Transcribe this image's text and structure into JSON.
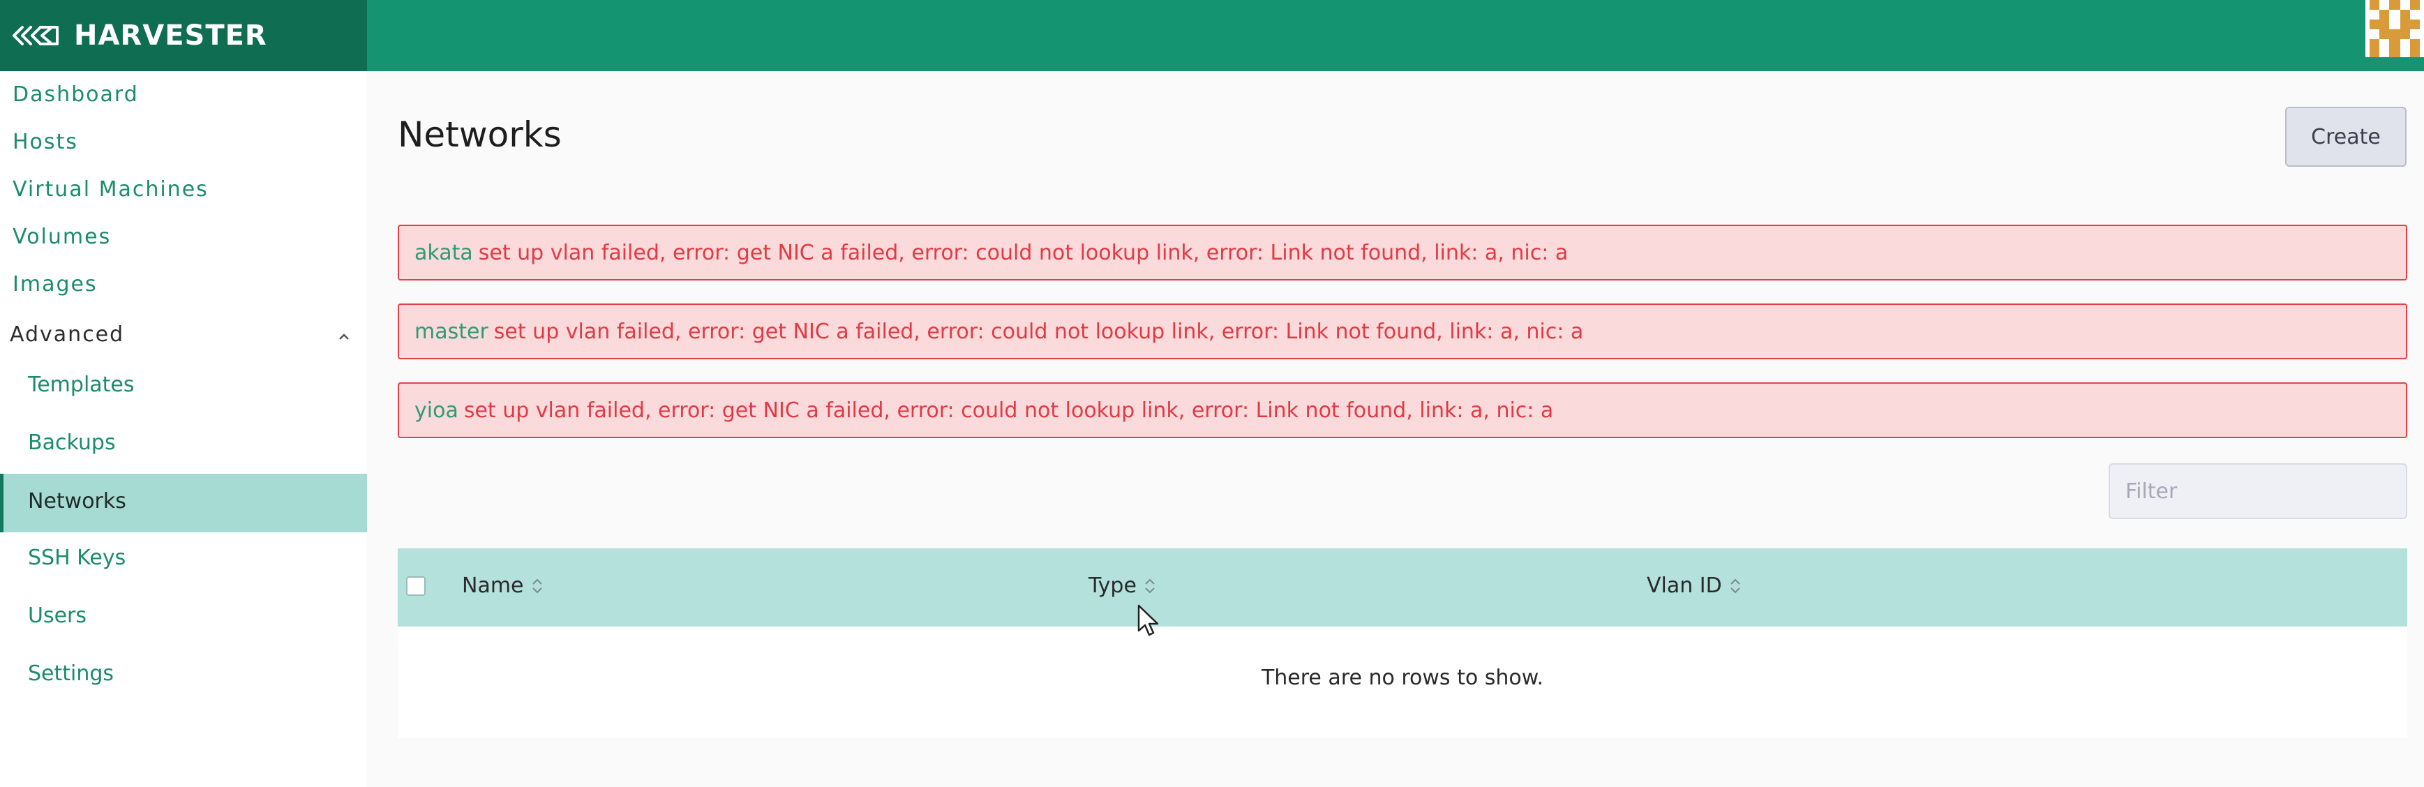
{
  "brand": {
    "name": "HARVESTER",
    "logo_icon": "harvester-logo-icon"
  },
  "colors": {
    "topbar": "#149470",
    "brand_bg": "#0f6d52",
    "nav_text": "#1b8c6b",
    "active_row": "#a5dbd2",
    "alert_bg": "#fadada",
    "alert_border": "#e5404a",
    "alert_text": "#e23a45",
    "table_head": "#b4e1dc"
  },
  "sidebar": {
    "items": [
      {
        "label": "Dashboard"
      },
      {
        "label": "Hosts"
      },
      {
        "label": "Virtual Machines"
      },
      {
        "label": "Volumes"
      },
      {
        "label": "Images"
      }
    ],
    "group": {
      "label": "Advanced",
      "expanded": true
    },
    "sub_items": [
      {
        "label": "Templates"
      },
      {
        "label": "Backups"
      },
      {
        "label": "Networks",
        "active": true
      },
      {
        "label": "SSH Keys"
      },
      {
        "label": "Users"
      },
      {
        "label": "Settings"
      }
    ]
  },
  "page": {
    "title": "Networks",
    "create_label": "Create"
  },
  "alerts": [
    {
      "host": "akata",
      "message": "set up vlan failed, error: get NIC a failed, error: could not lookup link, error: Link not found, link: a, nic: a"
    },
    {
      "host": "master",
      "message": "set up vlan failed, error: get NIC a failed, error: could not lookup link, error: Link not found, link: a, nic: a"
    },
    {
      "host": "yioa",
      "message": "set up vlan failed, error: get NIC a failed, error: could not lookup link, error: Link not found, link: a, nic: a"
    }
  ],
  "filter": {
    "placeholder": "Filter",
    "value": ""
  },
  "table": {
    "columns": [
      {
        "label": "Name"
      },
      {
        "label": "Type"
      },
      {
        "label": "Vlan ID"
      }
    ],
    "rows": [],
    "empty_message": "There are no rows to show."
  }
}
